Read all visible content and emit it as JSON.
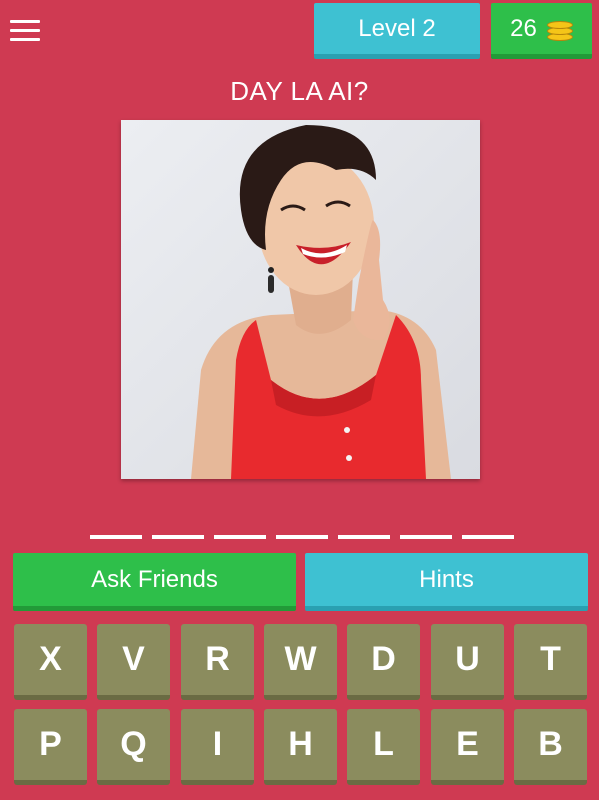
{
  "header": {
    "menu_icon": "hamburger-menu-icon",
    "level_label": "Level 2",
    "coins": "26",
    "coin_icon": "coin-stack-icon"
  },
  "question": "DAY LA AI?",
  "answer_slot_count": 7,
  "actions": {
    "ask_friends": "Ask Friends",
    "hints": "Hints"
  },
  "keyboard": {
    "row1": [
      "X",
      "V",
      "R",
      "W",
      "D",
      "U",
      "T"
    ],
    "row2": [
      "P",
      "Q",
      "I",
      "H",
      "L",
      "E",
      "B"
    ]
  },
  "colors": {
    "background": "#cf3a52",
    "blue_button": "#3ec1d2",
    "green_button": "#2ebf4a",
    "key_tile": "#8b8c5e"
  }
}
